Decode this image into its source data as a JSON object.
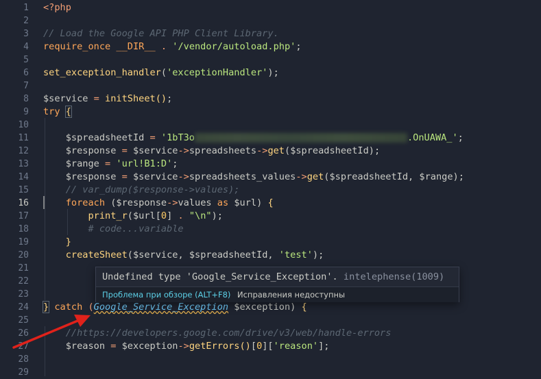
{
  "editor": {
    "language": "php",
    "active_line": "16",
    "line_numbers": [
      "1",
      "2",
      "3",
      "4",
      "5",
      "6",
      "7",
      "8",
      "9",
      "10",
      "11",
      "12",
      "13",
      "14",
      "15",
      "16",
      "17",
      "18",
      "19",
      "20",
      "21",
      "22",
      "23",
      "24",
      "25",
      "26",
      "27",
      "28",
      "29"
    ],
    "lines": {
      "l1": "<?php",
      "l3": "// Load the Google API PHP Client Library.",
      "l4_kw": "require_once",
      "l4_const": "__DIR__",
      "l4_op": " . ",
      "l4_str": "'/vendor/autoload.php'",
      "l4_end": ";",
      "l6_fn": "set_exception_handler",
      "l6_str": "'exceptionHandler'",
      "l8_var": "$service",
      "l8_op": " = ",
      "l8_fn": "initSheet",
      "l9_kw": "try",
      "l11_var": "$spreadsheetId",
      "l11_str_start": "'1bT3o",
      "l11_str_end": ".OnUAWA_'",
      "l12_var": "$response",
      "l12_obj": "$service",
      "l12_prop": "spreadsheets",
      "l12_fn": "get",
      "l12_arg": "$spreadsheetId",
      "l13_var": "$range",
      "l13_str": "'url!B1:D'",
      "l14_var": "$response",
      "l14_obj": "$service",
      "l14_prop": "spreadsheets_values",
      "l14_fn": "get",
      "l14_arg1": "$spreadsheetId",
      "l14_arg2": "$range",
      "l15_com": "// var_dump($response->values);",
      "l16_kw": "foreach",
      "l16_var": "$response",
      "l16_prop": "values",
      "l16_as": "as",
      "l16_var2": "$url",
      "l17_fn": "print_r",
      "l17_var": "$url",
      "l17_num": "0",
      "l17_str": "\"\\n\"",
      "l18_com": "# code...variable",
      "l20_fn": "createSheet",
      "l20_arg1": "$service",
      "l20_arg2": "$spreadsheetId",
      "l20_str": "'test'",
      "l24_kw": "catch",
      "l24_type": "Google_Service_Exception",
      "l24_var": "$exception",
      "l26_com": "//https://developers.google.com/drive/v3/web/handle-errors",
      "l27_var": "$reason",
      "l27_obj": "$exception",
      "l27_fn": "getErrors",
      "l27_num": "0",
      "l27_str": "'reason'"
    }
  },
  "hover": {
    "message": "Undefined type 'Google_Service_Exception'.",
    "source": "intelephense(1009)",
    "peek_label": "Проблема при обзоре (ALT+F8)",
    "fixes_label": "Исправления недоступны"
  },
  "colors": {
    "background": "#1f2430",
    "annotation_arrow": "#e0221b",
    "warning_underline": "#d1a24a"
  }
}
